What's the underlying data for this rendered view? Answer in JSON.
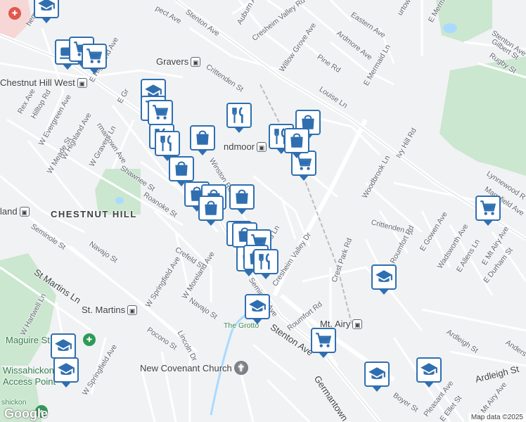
{
  "map": {
    "attribution": "Map data ©2025",
    "google_logo": "Google",
    "colors": {
      "background": "#f1f2f4",
      "park": "#cbe7cf",
      "road": "#ffffff",
      "pin_border": "#2f6fb0",
      "water": "#aadaff"
    }
  },
  "neighborhoods": {
    "chestnut_hill": "CHESTNUT HILL"
  },
  "places": {
    "gravers": "Gravers",
    "chestnut_hill_west": "Chestnut Hill West",
    "wyndmoor": "ndmoor",
    "st_martins": "St. Martins",
    "mt_airy": "Mt. Airy",
    "highland": "land",
    "new_covenant": "New Covenant Church",
    "the_grotto": "The Grotto",
    "maguire": "Maguire St",
    "wissahickon": "Wissahickon",
    "access_point": "Access Point",
    "shickon": "shickon"
  },
  "streets": {
    "stenton_ave_n": "Stenton Ave",
    "stenton_ave_s": "Stenton Ave",
    "auburn_ave": "Auburn Ave",
    "cresheim_valley_rd": "Cresheim Valley Rd",
    "eastern_ave": "Eastern Ave",
    "ardmore_ave": "Ardmore Ave",
    "willow_grove_ave": "Willow Grove Ave",
    "pine_rd": "Pine Rd",
    "crittenden_st_n": "Crittenden St",
    "louise_ln": "Louise Ln",
    "e_mermaid_ln": "E Mermaid Ln",
    "gilbert_st": "Gilbert St",
    "rugby_st": "Rugby St",
    "ivy_hill_rd": "Ivy Hill Rd",
    "lynnewood_rd": "Lynnewood R",
    "mansfield_ave": "Mansfield Ave",
    "woodbrook_ln": "Woodbrook Ln",
    "crittenden_st_s": "Crittenden St",
    "e_gowen_ave": "E Gowen Ave",
    "wadsworth_ave": "Wadsworth Ave",
    "e_allens_ln": "E Allens Ln",
    "e_mt_airy_ave": "E Mt Airy Ave",
    "e_durham_st": "E Durham St",
    "roumfort_rd_e": "Roumfort Rd",
    "crest_park_rd": "Crest Park Rd",
    "cresheim_valley_dr": "Cresheim Valley Dr",
    "roumfort_rd_s": "Roumfort Rd",
    "ardleigh_st_n": "Ardleigh St",
    "ardleigh_st_s": "Ardleigh St",
    "germantown_ave_s": "Germantown A",
    "germantown_ave_n": "rmantown Ave",
    "boyer_st": "Boyer St",
    "pleasant_ave": "Pleasant Ave",
    "e_ellet_st": "E Ellet St",
    "e_mt_airy_ave_s": "E Mt Airy Ave",
    "anders": "Anders",
    "rex_ave": "Rex Ave",
    "hilltop_rd": "Hilltop Rd",
    "w_evergreen_ave": "W Evergreen Ave",
    "w_highland_ave": "W Highland Ave",
    "e_highland_ave": "E Highland Ave",
    "w_graves_ln": "W Gravers Ln",
    "w_meade_st": "W Meade St",
    "shawnee_st": "Shawnee St",
    "winston_rd": "Winston Rd",
    "roanoke_st": "Roanoke St",
    "seminole_st": "Seminole St",
    "navajo_st_w": "Navajo St",
    "crefeld_st": "Crefeld St",
    "w_springfield_ave": "W Springfield Ave",
    "w_moreland_ave": "W Moreland Ave",
    "navajo_st_s": "Navajo St",
    "lincoln_dr": "Lincoln Dr",
    "st_martins_ln": "St Martins Ln",
    "w_hartwell_ln": "W Hartwell Ln",
    "pocono_st": "Pocono St",
    "w_springfield_ave_s": "W Springfield Ave",
    "seminole_ave": "Seminole Ave",
    "e_gravers": "E Gr",
    "stenton_ave_ne": "Stenton Ave",
    "prospect_ave": "pect Ave",
    "e_mermaid_n": "E Mermai",
    "ridge_n": "urtown Ave",
    "w_pike": "hem Pike",
    "e_moreland": "aid Ln",
    "ba_ln": "Ln"
  },
  "pins": [
    {
      "type": "school-icon"
    },
    {
      "type": "shopping-cart-icon"
    },
    {
      "type": "coffee-icon"
    },
    {
      "type": "shopping-cart-icon"
    },
    {
      "type": "shopping-cart-icon"
    },
    {
      "type": "school-icon"
    },
    {
      "type": "shopping-cart-icon"
    },
    {
      "type": "shopping-cart-icon"
    },
    {
      "type": "restaurant-icon"
    },
    {
      "type": "restaurant-icon"
    },
    {
      "type": "shopping-bag-icon"
    },
    {
      "type": "shopping-bag-icon"
    },
    {
      "type": "shopping-bag-icon"
    },
    {
      "type": "shopping-bag-icon"
    },
    {
      "type": "shopping-bag-icon"
    },
    {
      "type": "shopping-bag-icon"
    },
    {
      "type": "restaurant-icon"
    },
    {
      "type": "shopping-bag-icon"
    },
    {
      "type": "shopping-bag-icon"
    },
    {
      "type": "restaurant-icon"
    },
    {
      "type": "shopping-bag-icon"
    },
    {
      "type": "shopping-cart-icon"
    },
    {
      "type": "shopping-bag-icon"
    },
    {
      "type": "shopping-bag-icon"
    },
    {
      "type": "shopping-cart-icon"
    },
    {
      "type": "shopping-bag-icon"
    },
    {
      "type": "restaurant-icon"
    },
    {
      "type": "school-icon"
    },
    {
      "type": "shopping-cart-icon"
    },
    {
      "type": "shopping-cart-icon"
    },
    {
      "type": "school-icon"
    },
    {
      "type": "school-icon"
    },
    {
      "type": "school-icon"
    },
    {
      "type": "school-icon"
    },
    {
      "type": "school-icon"
    }
  ]
}
